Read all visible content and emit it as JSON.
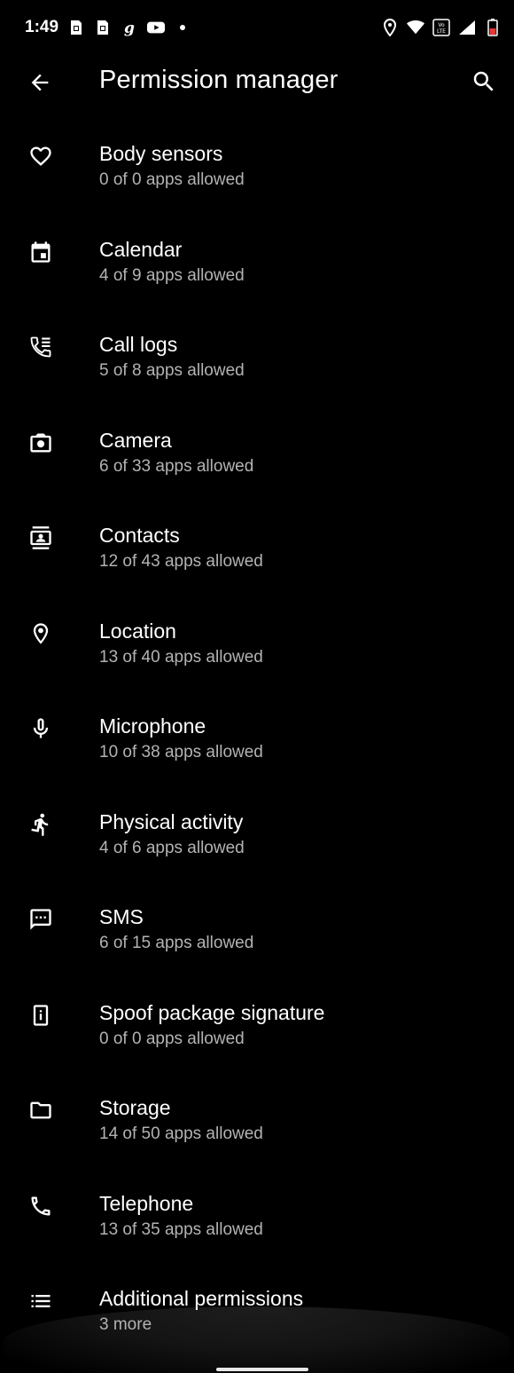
{
  "status_bar": {
    "time": "1:49",
    "left_icons": [
      "sim-card-icon",
      "sim-card-icon",
      "g-app-icon",
      "youtube-icon",
      "dot-icon"
    ],
    "right_icons": [
      "location-icon",
      "wifi-icon",
      "volte-icon",
      "signal-icon",
      "battery-icon"
    ],
    "volte_text": "VoLTE",
    "battery_color": "#e53935"
  },
  "app_bar": {
    "title": "Permission manager",
    "back_icon": "arrow-back-icon",
    "search_icon": "search-icon"
  },
  "permissions": [
    {
      "icon": "heart-icon",
      "label": "Body sensors",
      "summary": "0 of 0 apps allowed"
    },
    {
      "icon": "calendar-icon",
      "label": "Calendar",
      "summary": "4 of 9 apps allowed"
    },
    {
      "icon": "call-log-icon",
      "label": "Call logs",
      "summary": "5 of 8 apps allowed"
    },
    {
      "icon": "camera-icon",
      "label": "Camera",
      "summary": "6 of 33 apps allowed"
    },
    {
      "icon": "contacts-icon",
      "label": "Contacts",
      "summary": "12 of 43 apps allowed"
    },
    {
      "icon": "location-pin-icon",
      "label": "Location",
      "summary": "13 of 40 apps allowed"
    },
    {
      "icon": "microphone-icon",
      "label": "Microphone",
      "summary": "10 of 38 apps allowed"
    },
    {
      "icon": "running-icon",
      "label": "Physical activity",
      "summary": "4 of 6 apps allowed"
    },
    {
      "icon": "sms-icon",
      "label": "SMS",
      "summary": "6 of 15 apps allowed"
    },
    {
      "icon": "info-device-icon",
      "label": "Spoof package signature",
      "summary": "0 of 0 apps allowed"
    },
    {
      "icon": "folder-icon",
      "label": "Storage",
      "summary": "14 of 50 apps allowed"
    },
    {
      "icon": "phone-icon",
      "label": "Telephone",
      "summary": "13 of 35 apps allowed"
    },
    {
      "icon": "list-icon",
      "label": "Additional permissions",
      "summary": "3 more"
    }
  ],
  "colors": {
    "background": "#000000",
    "primary_text": "#ffffff",
    "secondary_text": "#b3b3b3"
  }
}
